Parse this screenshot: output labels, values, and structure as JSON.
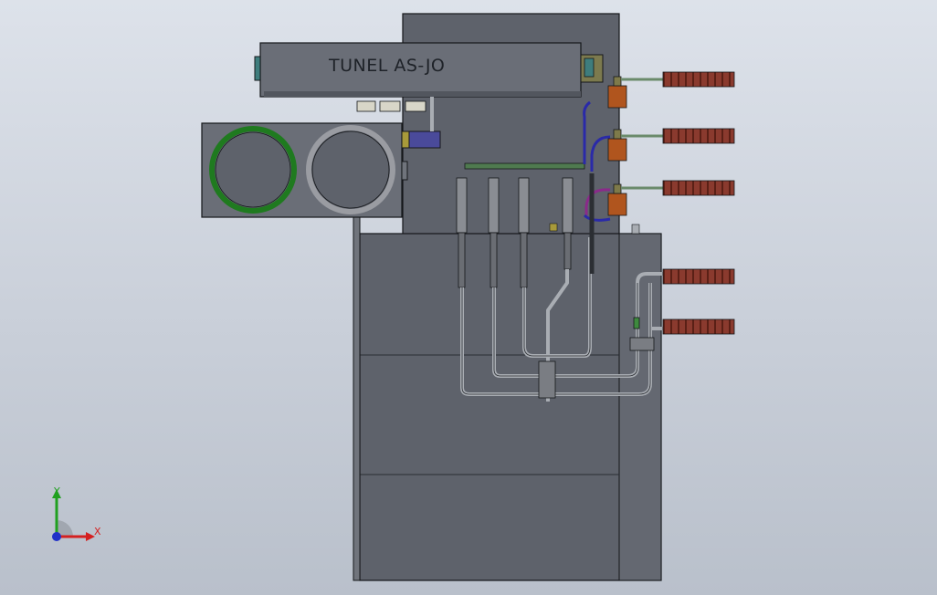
{
  "model": {
    "title_label": "TUNEL AS-JO"
  },
  "triad": {
    "x_label": "X",
    "y_label": "Y",
    "colors": {
      "x": "#d42020",
      "y": "#20a020",
      "z": "#2030c8"
    }
  },
  "palette": {
    "panel": "#5e626b",
    "panel_light": "#6a6e77",
    "outline": "#15171a",
    "ring_green": "#1f7a1f",
    "ring_gray": "#9a9ca2",
    "pipe": "#a9adb3",
    "connector_red": "#8a3a2e",
    "valve_orange": "#b0551e",
    "hose_blue": "#2a2aa8",
    "hose_purple": "#8a2a8a"
  },
  "connectors": [
    {
      "label": "",
      "kind": "upper"
    },
    {
      "label": "",
      "kind": "upper"
    },
    {
      "label": "",
      "kind": "upper"
    },
    {
      "label": "",
      "kind": "lower"
    },
    {
      "label": "",
      "kind": "lower"
    }
  ]
}
